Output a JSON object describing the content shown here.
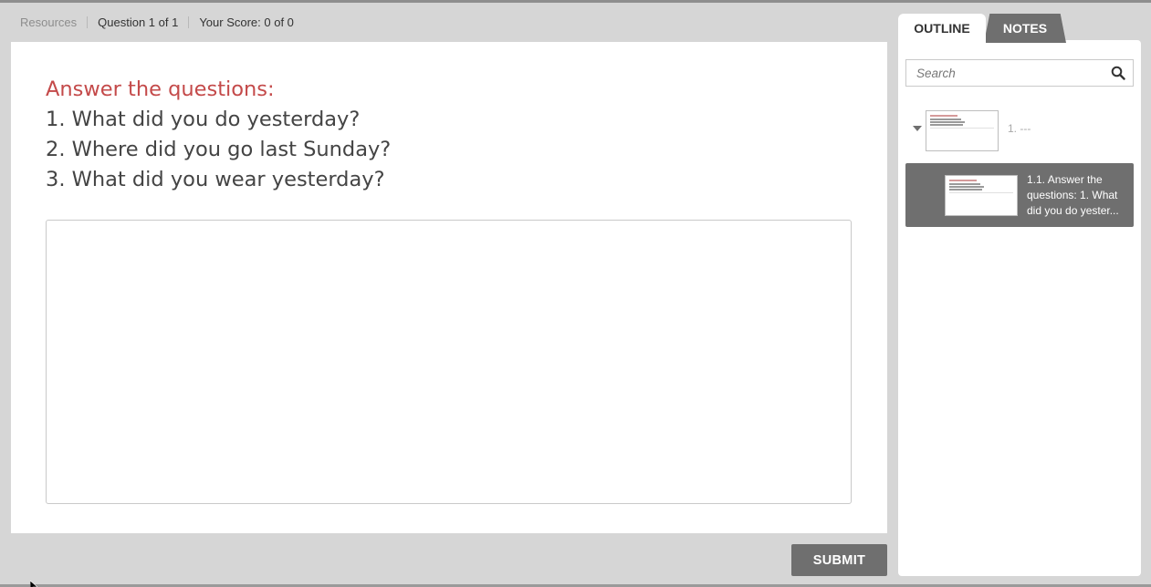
{
  "topbar": {
    "resources": "Resources",
    "question_counter": "Question 1 of 1",
    "score": "Your Score: 0 of 0"
  },
  "slide": {
    "title": "Answer the questions:",
    "questions": [
      "1. What did you do yesterday?",
      "2. Where did you go last Sunday?",
      "3. What did you wear yesterday?"
    ],
    "answer_value": ""
  },
  "submit_label": "SUBMIT",
  "sidebar": {
    "tabs": [
      {
        "label": "OUTLINE",
        "active": true
      },
      {
        "label": "NOTES",
        "active": false
      }
    ],
    "search_placeholder": "Search",
    "outline": [
      {
        "label": "1. ---",
        "selected": false
      },
      {
        "label": "1.1. Answer the questions: 1. What did you do yester...",
        "selected": true
      }
    ]
  },
  "colors": {
    "title_red": "#c44a4a",
    "button_gray": "#6f6f6f",
    "background": "#d6d6d6"
  }
}
